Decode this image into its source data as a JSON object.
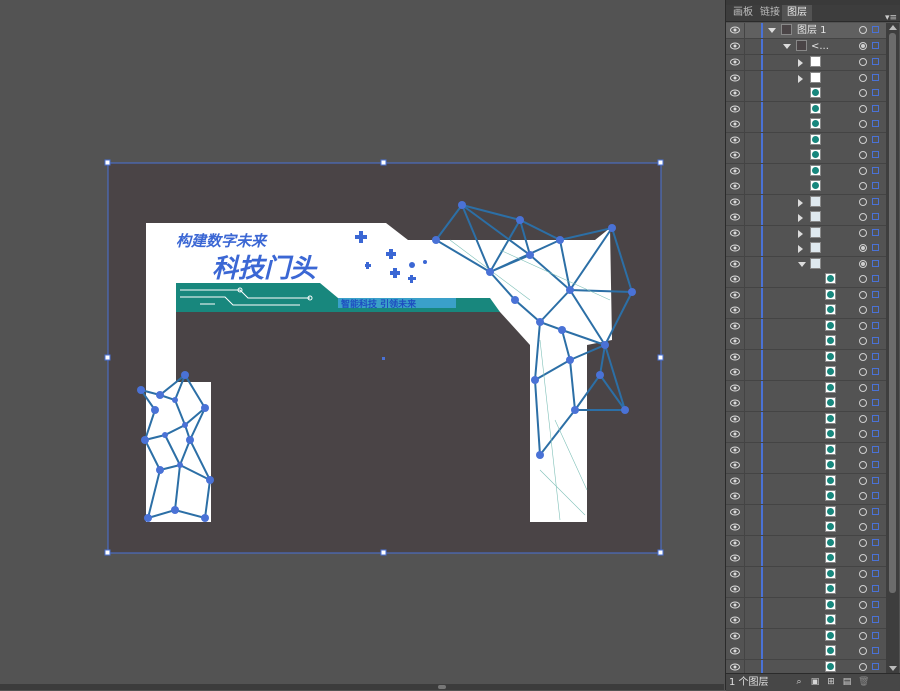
{
  "panel": {
    "tabs": [
      "画板",
      "链接",
      "图层"
    ],
    "active_tab": "图层",
    "menu_icon": "panel-menu-icon",
    "footer": {
      "layer_count": "1 个图层"
    },
    "layer_name": "图层 1",
    "group_name": "<..."
  },
  "colors": {
    "workspace": "#535353",
    "artboard_bg": "#4a4446",
    "selection": "#4a72d6",
    "teal": "#18877d",
    "line_blue": "#2c6fa6"
  },
  "artwork": {
    "title_small": "构建数字未来",
    "title_big": "科技门头",
    "subtitle": "智能科技 引领未来"
  }
}
